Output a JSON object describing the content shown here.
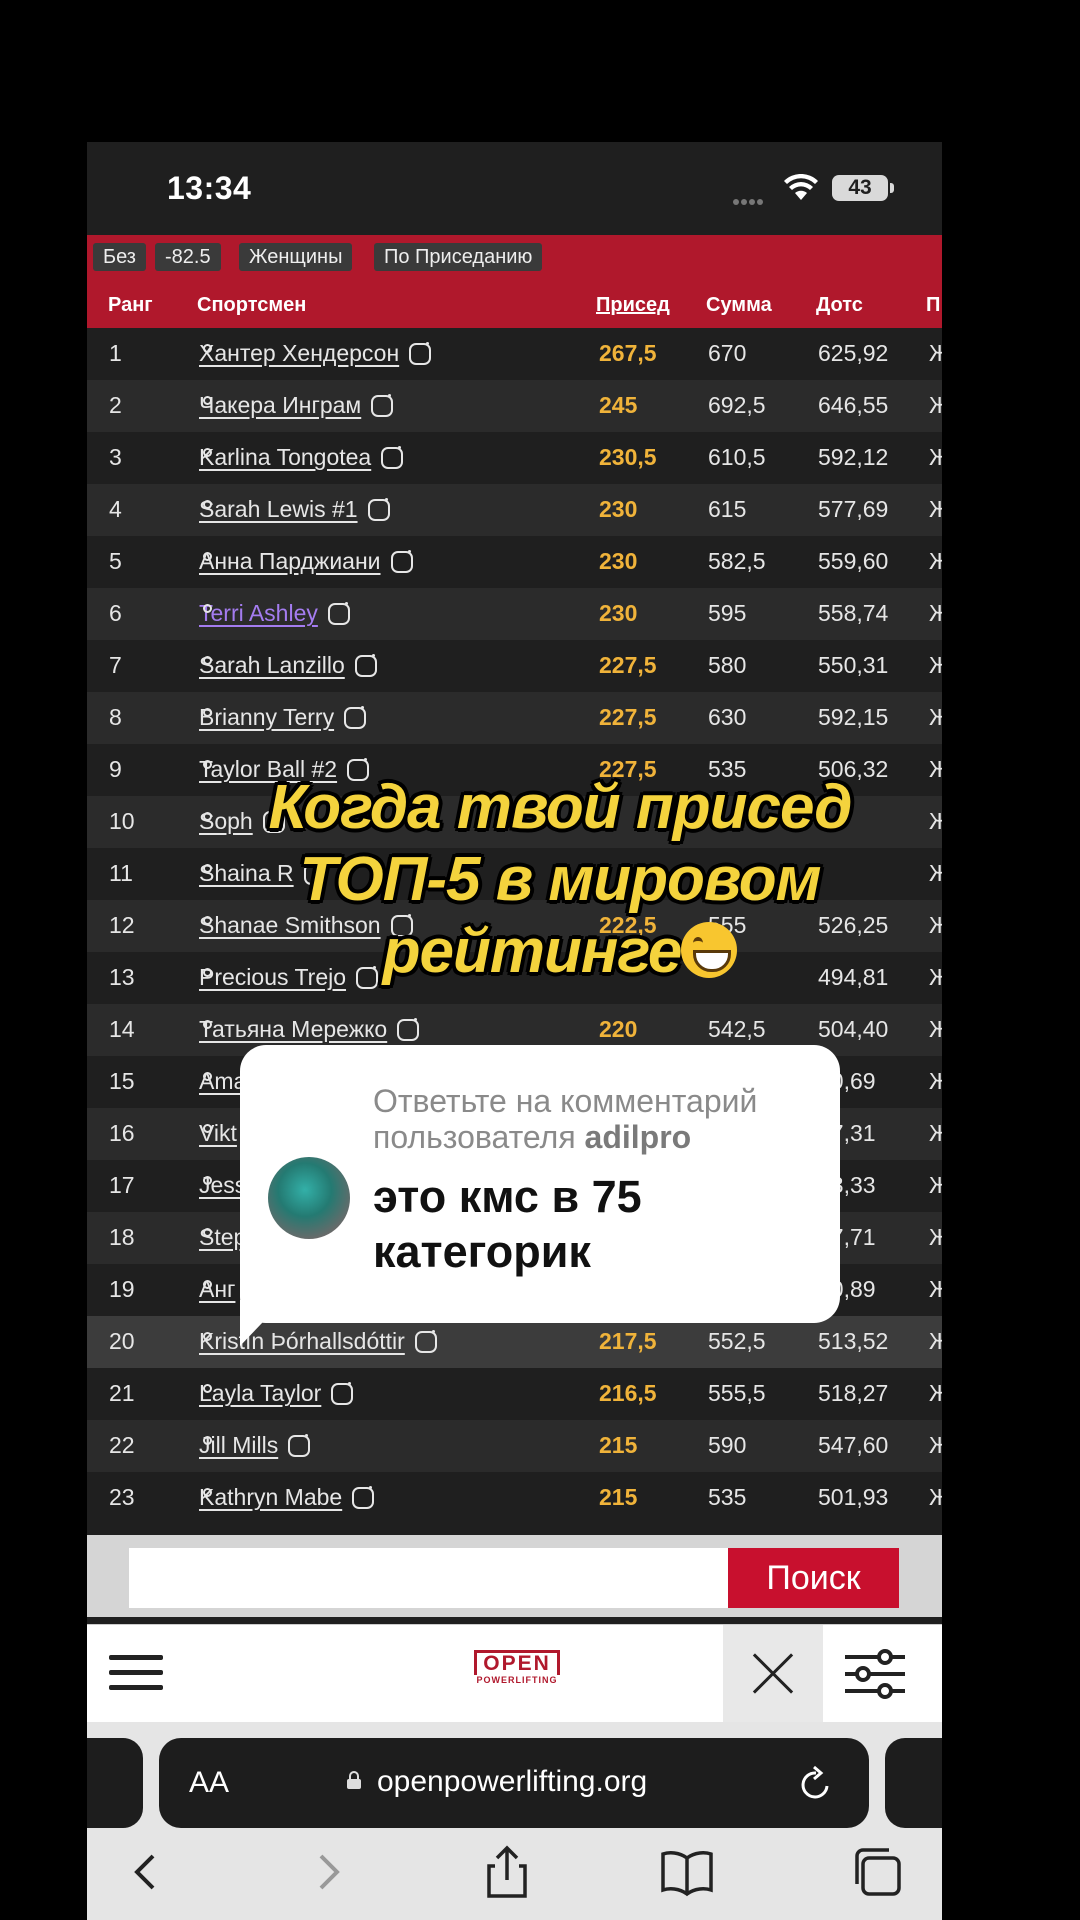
{
  "status": {
    "time": "13:34",
    "battery": "43"
  },
  "filters": [
    "Без",
    "-82.5",
    "Женщины",
    "По Приседанию"
  ],
  "table": {
    "headers": {
      "rank": "Ранг",
      "athlete": "Спортсмен",
      "squat": "Присед",
      "total": "Сумма",
      "dots": "Дотс",
      "sex": "П"
    },
    "rows": [
      {
        "rank": "1",
        "name": "Хантер Хендерсон",
        "squat": "267,5",
        "total": "670",
        "dots": "625,92",
        "sex": "Ж"
      },
      {
        "rank": "2",
        "name": "Чакера Инграм",
        "squat": "245",
        "total": "692,5",
        "dots": "646,55",
        "sex": "Ж"
      },
      {
        "rank": "3",
        "name": "Karlina Tongotea",
        "squat": "230,5",
        "total": "610,5",
        "dots": "592,12",
        "sex": "Ж"
      },
      {
        "rank": "4",
        "name": "Sarah Lewis #1",
        "squat": "230",
        "total": "615",
        "dots": "577,69",
        "sex": "Ж"
      },
      {
        "rank": "5",
        "name": "Анна Парджиани",
        "squat": "230",
        "total": "582,5",
        "dots": "559,60",
        "sex": "Ж"
      },
      {
        "rank": "6",
        "name": "Terri Ashley",
        "squat": "230",
        "total": "595",
        "dots": "558,74",
        "sex": "Ж",
        "visited": true
      },
      {
        "rank": "7",
        "name": "Sarah Lanzillo",
        "squat": "227,5",
        "total": "580",
        "dots": "550,31",
        "sex": "Ж"
      },
      {
        "rank": "8",
        "name": "Brianny Terry",
        "squat": "227,5",
        "total": "630",
        "dots": "592,15",
        "sex": "Ж"
      },
      {
        "rank": "9",
        "name": "Taylor Ball #2",
        "squat": "227,5",
        "total": "535",
        "dots": "506,32",
        "sex": "Ж"
      },
      {
        "rank": "10",
        "name": "Soph",
        "squat": "",
        "total": "",
        "dots": "",
        "sex": "Ж"
      },
      {
        "rank": "11",
        "name": "Shaina R",
        "squat": "",
        "total": "",
        "dots": "",
        "sex": "Ж"
      },
      {
        "rank": "12",
        "name": "Shanae Smithson",
        "squat": "222,5",
        "total": "555",
        "dots": "526,25",
        "sex": "Ж"
      },
      {
        "rank": "13",
        "name": "Precious Trejo",
        "squat": "",
        "total": "",
        "dots": "494,81",
        "sex": "Ж"
      },
      {
        "rank": "14",
        "name": "Татьяна Мережко",
        "squat": "220",
        "total": "542,5",
        "dots": "504,40",
        "sex": "Ж"
      },
      {
        "rank": "15",
        "name": "Ama",
        "squat": "",
        "total": "",
        "dots": "90,69",
        "sex": "Ж"
      },
      {
        "rank": "16",
        "name": "Vikt",
        "squat": "",
        "total": "",
        "dots": "67,31",
        "sex": "Ж"
      },
      {
        "rank": "17",
        "name": "Jess",
        "squat": "",
        "total": "",
        "dots": "63,33",
        "sex": "Ж"
      },
      {
        "rank": "18",
        "name": "Step",
        "squat": "",
        "total": "",
        "dots": "07,71",
        "sex": "Ж"
      },
      {
        "rank": "19",
        "name": "Анг",
        "squat": "",
        "total": "",
        "dots": "20,89",
        "sex": "Ж"
      },
      {
        "rank": "20",
        "name": "Kristín Þórhallsdóttir",
        "squat": "217,5",
        "total": "552,5",
        "dots": "513,52",
        "sex": "Ж"
      },
      {
        "rank": "21",
        "name": "Layla Taylor",
        "squat": "216,5",
        "total": "555,5",
        "dots": "518,27",
        "sex": "Ж"
      },
      {
        "rank": "22",
        "name": "Jill Mills",
        "squat": "215",
        "total": "590",
        "dots": "547,60",
        "sex": "Ж"
      },
      {
        "rank": "23",
        "name": "Kathryn Mabe",
        "squat": "215",
        "total": "535",
        "dots": "501,93",
        "sex": "Ж"
      }
    ]
  },
  "search": {
    "button": "Поиск",
    "placeholder": ""
  },
  "logo": {
    "top": "OPEN",
    "bottom": "POWERLIFTING"
  },
  "browser": {
    "aa": "AA",
    "url": "openpowerlifting.org"
  },
  "caption": {
    "line1": "Когда твой присед",
    "line2": "ТОП-5 в мировом",
    "line3": "рейтинге"
  },
  "comment": {
    "reply_prefix": "Ответьте на комментарий пользователя",
    "username": "adilpro",
    "text": "это кмс в 75 категорик"
  },
  "colors": {
    "brand_red": "#b0182c",
    "squat_gold": "#f0b33a",
    "caption_yellow": "#f4d33d",
    "visited_link": "#a47cf0"
  }
}
